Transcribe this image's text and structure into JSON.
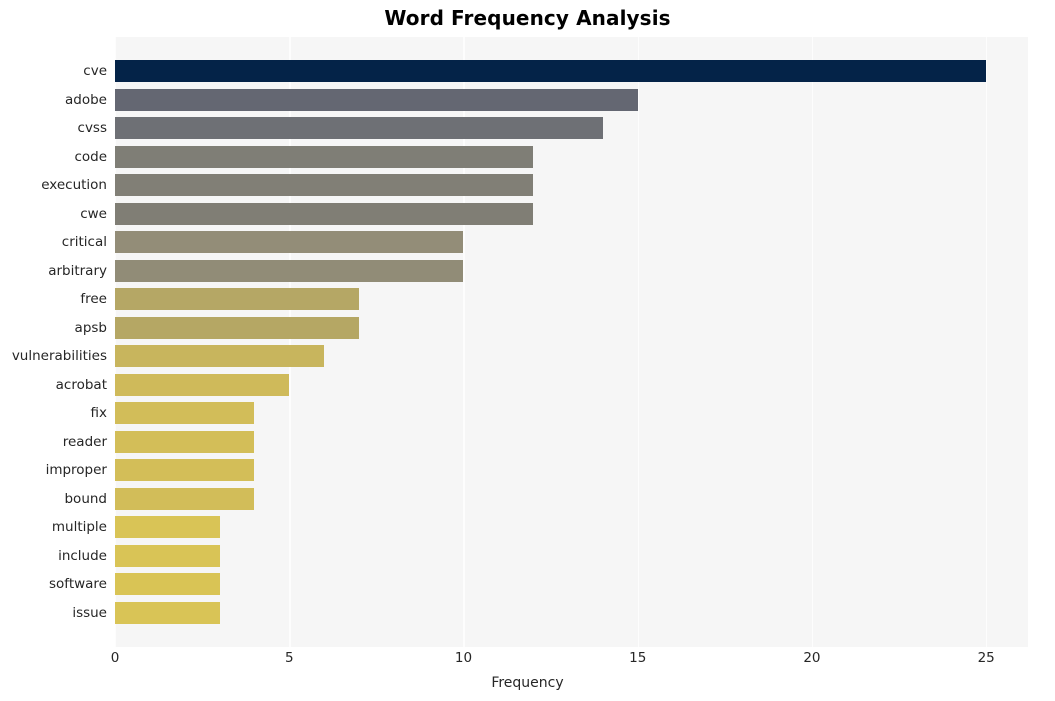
{
  "chart_data": {
    "type": "bar",
    "orientation": "horizontal",
    "title": "Word Frequency Analysis",
    "xlabel": "Frequency",
    "ylabel": "",
    "xlim": [
      0,
      26.2
    ],
    "ylim": [
      0,
      20
    ],
    "xticks": [
      0,
      5,
      10,
      15,
      20,
      25
    ],
    "xtick_labels": [
      "0",
      "5",
      "10",
      "15",
      "20",
      "25"
    ],
    "grid": "vertical",
    "legend": "none",
    "categories": [
      "cve",
      "adobe",
      "cvss",
      "code",
      "execution",
      "cwe",
      "critical",
      "arbitrary",
      "free",
      "apsb",
      "vulnerabilities",
      "acrobat",
      "fix",
      "reader",
      "improper",
      "bound",
      "multiple",
      "include",
      "software",
      "issue"
    ],
    "values": [
      25,
      15,
      14,
      12,
      12,
      12,
      10,
      10,
      7,
      7,
      6,
      5,
      4,
      4,
      4,
      4,
      3,
      3,
      3,
      3
    ],
    "bar_colors": [
      "#042348",
      "#646772",
      "#6e7075",
      "#7f7e76",
      "#817f76",
      "#807e75",
      "#938d78",
      "#918c77",
      "#b5a765",
      "#b5a764",
      "#c8b55d",
      "#cfba5a",
      "#d2bd59",
      "#d3be58",
      "#d3be58",
      "#d2bd59",
      "#d9c456",
      "#d9c456",
      "#d9c455",
      "#d9c456"
    ],
    "plot_background": "#f6f6f6",
    "figure_background": "#ffffff",
    "gridline_color": "#fdfdfd"
  }
}
